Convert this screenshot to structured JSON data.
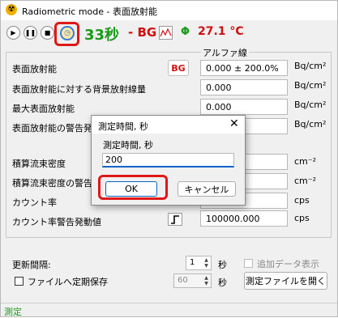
{
  "window": {
    "title": "Radiometric mode - 表面放射能"
  },
  "toolbar": {
    "timer_value": "33秒",
    "bg_status": "- BG",
    "phi_symbol": "Φ",
    "temperature": "27.1 °C",
    "icons": [
      "play-icon",
      "pause-icon",
      "stop-icon",
      "timer-icon",
      "graph-icon"
    ]
  },
  "group": {
    "title": "アルファ線"
  },
  "rows": [
    {
      "label": "表面放射能",
      "value": "0.000 ± 200.0%",
      "unit": "Bq/cm²",
      "button": "BG"
    },
    {
      "label": "表面放射能に対する背景放射線量",
      "value": "0.000",
      "unit": "Bq/cm²"
    },
    {
      "label": "最大表面放射能",
      "value": "0.000",
      "unit": "Bq/cm²"
    },
    {
      "label": "表面放射能の警告発",
      "value": "0",
      "unit": "Bq/cm²"
    },
    {
      "label": "積算流束密度",
      "value": "",
      "unit": "cm⁻²"
    },
    {
      "label": "積算流束密度の警告",
      "value": "0",
      "unit": "cm⁻²"
    },
    {
      "label": "カウント率",
      "value": "0.0%",
      "unit": "cps"
    },
    {
      "label": "カウント率警告発動値",
      "value": "100000.000",
      "unit": "cps"
    }
  ],
  "bottom": {
    "update_interval_label": "更新間隔:",
    "update_interval_value": "1",
    "update_interval_unit": "秒",
    "auto_display_label": "追加データ表示",
    "save_periodic_label": "ファイルへ定期保存",
    "save_interval_value": "60",
    "save_interval_unit": "秒",
    "open_file_button": "測定ファイルを開く"
  },
  "status": {
    "text": "測定"
  },
  "dialog": {
    "title": "測定時間, 秒",
    "close": "✕",
    "prompt": "測定時間, 秒",
    "input_value": "200",
    "ok_label": "OK",
    "cancel_label": "キャンセル"
  },
  "colors": {
    "accent_green": "#1a9a1a",
    "accent_red": "#d01010",
    "highlight": "#e01818"
  }
}
